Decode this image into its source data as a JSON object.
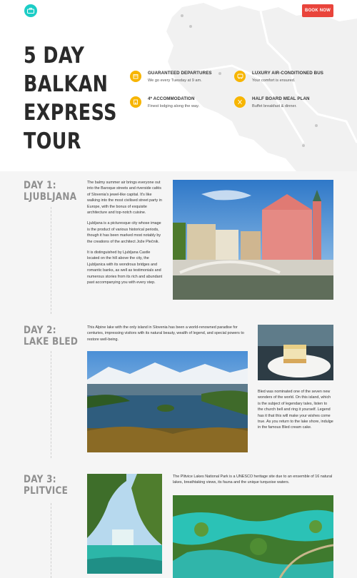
{
  "header": {
    "book_label": "BOOK NOW"
  },
  "hero": {
    "title_lines": [
      "5 DAY",
      "BALKAN",
      "EXPRESS",
      "TOUR"
    ],
    "features": [
      {
        "icon": "calendar-icon",
        "title": "GUARANTEED DEPARTURES",
        "desc": "We go every Tuesday at 9 am."
      },
      {
        "icon": "bus-icon",
        "title": "LUXURY AIR-CONDITIONED BUS",
        "desc": "Your comfort is ensured."
      },
      {
        "icon": "hotel-icon",
        "title": "4* ACCOMMODATION",
        "desc": "Finest lodging along the way."
      },
      {
        "icon": "meal-icon",
        "title": "HALF BOARD MEAL PLAN",
        "desc": "Buffet breakfast & dinner."
      }
    ]
  },
  "days": [
    {
      "heading": [
        "DAY 1:",
        "LJUBLJANA"
      ],
      "paragraphs": [
        "The balmy summer air brings everyone out into the Baroque streets and riverside cafés of Slovenia's jewel-like capital. It's like walking into the most civilised street party in Europe, with the bonus of exquisite architecture and top-notch cuisine.",
        "Ljubljana is a picturesque city whose image is the product of various historical periods, though it has been marked most notably by the creations of the architect Jože Plečnik.",
        "It is distinguished by Ljubljana Castle located on the hill above the city, the Ljubljanica with its wondrous bridges and romantic banks, as well as testimonials and numerous stories from its rich and abundant past accompanying you with every step."
      ]
    },
    {
      "heading": [
        "DAY 2:",
        "LAKE BLED"
      ],
      "paragraphs": [
        "This Alpine lake with the only island in Slovenia has been a world-renowned paradise for centuries, impressing visitors with its natural beauty, wealth of legend, and special powers to restore well-being.",
        "Bled was nominated one of the seven new wonders of the world. On this island, which is the subject of legendary tales, listen to the church bell and ring it yourself. Legend has it that this will make your wishes come true. As you return to the lake shore, indulge in the famous Bled cream cake."
      ]
    },
    {
      "heading": [
        "DAY 3:",
        "PLITVICE"
      ],
      "paragraphs": [
        "The Plitvice Lakes National Park is a UNESCO heritage site due to an ensemble of 16 natural lakes, breathtaking views, its fauna and the unique turquoise waters."
      ]
    }
  ]
}
